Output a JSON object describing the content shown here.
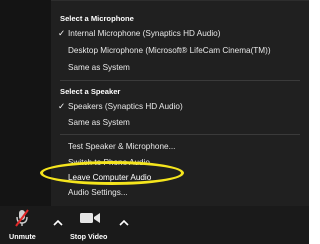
{
  "menu": {
    "microphone_title": "Select a Microphone",
    "microphones": [
      "Internal Microphone (Synaptics HD Audio)",
      "Desktop Microphone (Microsoft® LifeCam Cinema(TM))",
      "Same as System"
    ],
    "speaker_title": "Select a Speaker",
    "speakers": [
      "Speakers (Synaptics HD Audio)",
      "Same as System"
    ],
    "actions": [
      "Test Speaker & Microphone...",
      "Switch to Phone Audio...",
      "Leave Computer Audio",
      "Audio Settings..."
    ],
    "check_mark": "✓"
  },
  "toolbar": {
    "unmute_label": "Unmute",
    "stop_video_label": "Stop Video"
  },
  "colors": {
    "highlight": "#f5e51d",
    "mute_slash": "#e02828"
  }
}
